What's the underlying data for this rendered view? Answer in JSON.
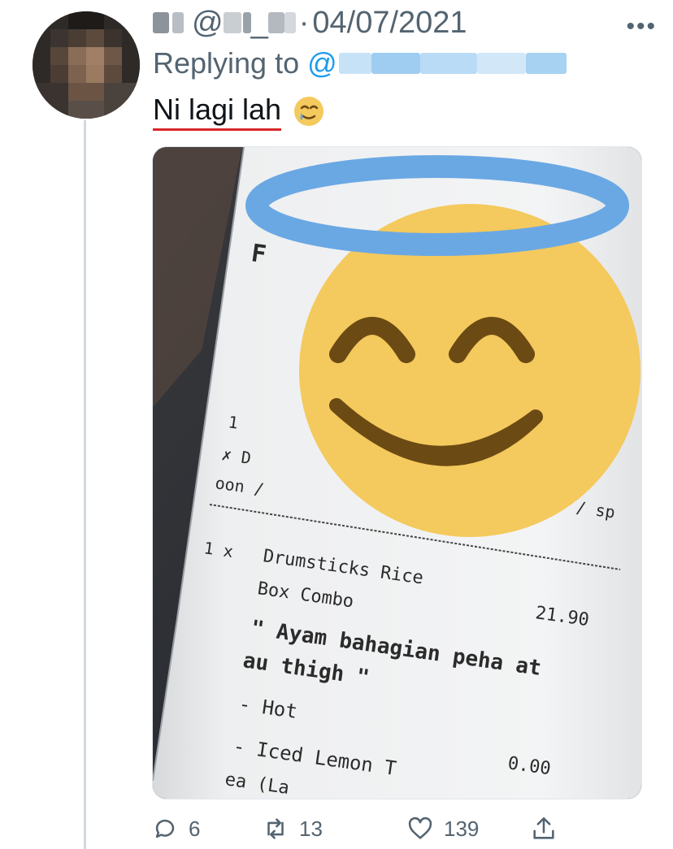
{
  "tweet": {
    "author_name": "F█ █",
    "handle_prefix": "@",
    "handle_blurred": "██_███",
    "separator": "·",
    "date": "04/07/2021",
    "more_label": "•••",
    "replying_label": "Replying to",
    "replying_at": "@",
    "text": "Ni lagi lah",
    "text_emoji": "smiling-face-with-tear-icon"
  },
  "receipt": {
    "top_fragment": "F",
    "left_1": "1",
    "left_x": "✗ D",
    "left_oon": "oon /",
    "right_sp": "/ sp",
    "line1_qty": "1 x",
    "line1_item": "Drumsticks Rice",
    "line1_item2": "Box Combo",
    "line1_price": "21.90",
    "note_line1": "\" Ayam bahagian peha at",
    "note_line2": "au thigh \"",
    "opt_hot": "- Hot",
    "opt_tea": "- Iced Lemon T",
    "opt_tea2": "ea (La",
    "opt_price": "0.00",
    "overlay_emoji": "smiling-face-with-halo-icon"
  },
  "actions": {
    "reply_count": "6",
    "retweet_count": "13",
    "like_count": "139"
  },
  "icons": {
    "reply": "reply-icon",
    "retweet": "retweet-icon",
    "like": "heart-icon",
    "share": "share-icon"
  },
  "colors": {
    "muted": "#536471",
    "link": "#1d9bf0",
    "underline": "#d9262a",
    "emoji_yellow": "#f4c95d",
    "halo_blue": "#6aa8e4"
  }
}
